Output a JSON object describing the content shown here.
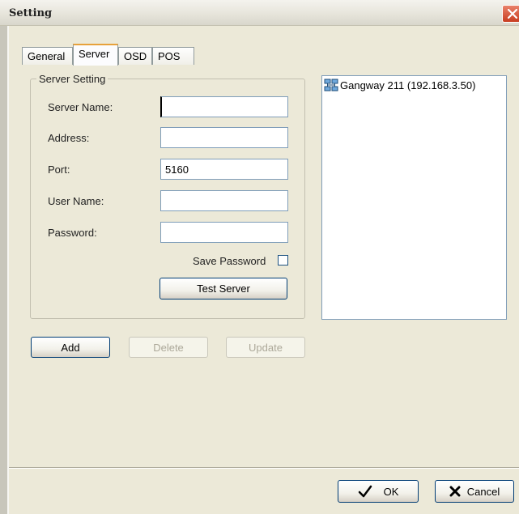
{
  "window": {
    "title": "Setting"
  },
  "tabs": [
    {
      "label": "General",
      "active": false
    },
    {
      "label": "Server",
      "active": true
    },
    {
      "label": "OSD",
      "active": false
    },
    {
      "label": "POS",
      "active": false
    }
  ],
  "server_setting": {
    "group_label": "Server Setting",
    "server_name": {
      "label": "Server Name:",
      "value": ""
    },
    "address": {
      "label": "Address:",
      "value": ""
    },
    "port": {
      "label": "Port:",
      "value": "5160"
    },
    "user_name": {
      "label": "User Name:",
      "value": ""
    },
    "password": {
      "label": "Password:",
      "value": ""
    },
    "save_password": {
      "label": "Save Password",
      "checked": false
    },
    "test_server_label": "Test Server"
  },
  "server_list": {
    "items": [
      {
        "label": "Gangway 211 (192.168.3.50)",
        "icon": "network-server-icon"
      }
    ]
  },
  "actions": {
    "add_label": "Add",
    "delete_label": "Delete",
    "delete_enabled": false,
    "update_label": "Update",
    "update_enabled": false
  },
  "footer": {
    "ok_label": "OK",
    "cancel_label": "Cancel"
  },
  "colors": {
    "window_bg": "#ece9d8",
    "border_blue": "#7f9db9",
    "tab_accent": "#e7a13b",
    "close_red": "#c83d20"
  }
}
